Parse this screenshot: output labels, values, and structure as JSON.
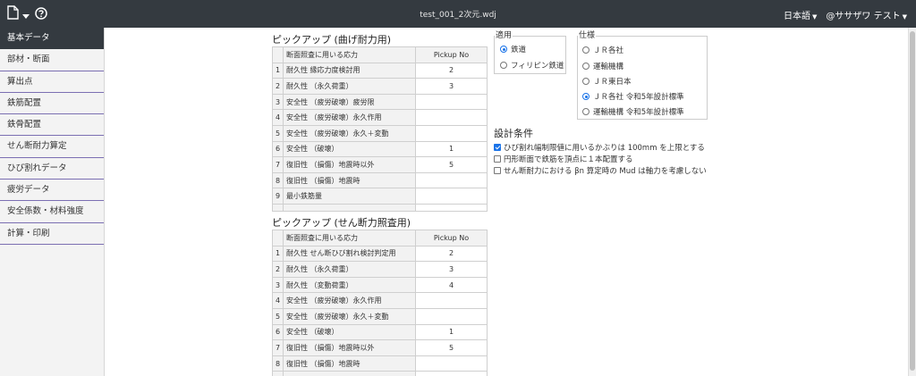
{
  "app": {
    "title": "test_001_2次元.wdj",
    "language_menu": "日本語",
    "user_menu": "@ササザワ テスト"
  },
  "icons": {
    "file": "file-icon",
    "dropdown": "caret-down-icon",
    "help": "help-circle-icon",
    "user": "at-icon"
  },
  "sidebar": {
    "items": [
      {
        "label": "基本データ",
        "active": true
      },
      {
        "label": "部材・断面"
      },
      {
        "label": "算出点"
      },
      {
        "label": "鉄筋配置"
      },
      {
        "label": "鉄骨配置"
      },
      {
        "label": "せん断耐力算定"
      },
      {
        "label": "ひび割れデータ"
      },
      {
        "label": "疲労データ"
      },
      {
        "label": "安全係数・材料強度"
      },
      {
        "label": "計算・印刷"
      }
    ]
  },
  "pickup_bending": {
    "title": "ピックアップ (曲げ耐力用)",
    "col_label": "断面照査に用いる応力",
    "col_value": "Pickup No",
    "rows": [
      {
        "no": "1",
        "label": "耐久性 縁応力度検討用",
        "value": "2"
      },
      {
        "no": "2",
        "label": "耐久性 （永久荷重）",
        "value": "3"
      },
      {
        "no": "3",
        "label": "安全性 （疲労破壊）疲労限",
        "value": ""
      },
      {
        "no": "4",
        "label": "安全性 （疲労破壊）永久作用",
        "value": ""
      },
      {
        "no": "5",
        "label": "安全性 （疲労破壊）永久＋変動",
        "value": ""
      },
      {
        "no": "6",
        "label": "安全性 （破壊）",
        "value": "1"
      },
      {
        "no": "7",
        "label": "復旧性 （損傷）地震時以外",
        "value": "5"
      },
      {
        "no": "8",
        "label": "復旧性 （損傷）地震時",
        "value": ""
      },
      {
        "no": "9",
        "label": "最小鉄筋量",
        "value": ""
      }
    ]
  },
  "pickup_shear": {
    "title": "ピックアップ (せん断力照査用)",
    "col_label": "断面照査に用いる応力",
    "col_value": "Pickup No",
    "rows": [
      {
        "no": "1",
        "label": "耐久性 せん断ひび割れ検討判定用",
        "value": "2"
      },
      {
        "no": "2",
        "label": "耐久性 （永久荷重）",
        "value": "3"
      },
      {
        "no": "3",
        "label": "耐久性 （変動荷重）",
        "value": "4"
      },
      {
        "no": "4",
        "label": "安全性 （疲労破壊）永久作用",
        "value": ""
      },
      {
        "no": "5",
        "label": "安全性 （疲労破壊）永久＋変動",
        "value": ""
      },
      {
        "no": "6",
        "label": "安全性 （破壊）",
        "value": "1"
      },
      {
        "no": "7",
        "label": "復旧性 （損傷）地震時以外",
        "value": "5"
      },
      {
        "no": "8",
        "label": "復旧性 （損傷）地震時",
        "value": ""
      }
    ]
  },
  "application": {
    "legend": "適用",
    "options": [
      {
        "label": "鉄道",
        "selected": true
      },
      {
        "label": "フィリピン鉄道",
        "selected": false
      }
    ]
  },
  "specification": {
    "legend": "仕様",
    "options": [
      {
        "label": "ＪＲ各社",
        "selected": false
      },
      {
        "label": "運輸機構",
        "selected": false
      },
      {
        "label": "ＪＲ東日本",
        "selected": false
      },
      {
        "label": "ＪＲ各社 令和5年設計標準",
        "selected": true
      },
      {
        "label": "運輸機構 令和5年設計標準",
        "selected": false
      }
    ]
  },
  "design_conditions": {
    "title": "設計条件",
    "options": [
      {
        "label": "ひび割れ幅制限値に用いるかぶりは 100mm を上限とする",
        "checked": true
      },
      {
        "label": "円形断面で鉄筋を頂点に１本配置する",
        "checked": false
      },
      {
        "label": "せん断耐力における βn 算定時の Mud は軸力を考慮しない",
        "checked": false
      }
    ]
  },
  "colors": {
    "topbar": "#343a40",
    "sidebar_active": "#343a40",
    "sidebar_divider": "#7b6fb2",
    "accent": "#1a73e8"
  }
}
